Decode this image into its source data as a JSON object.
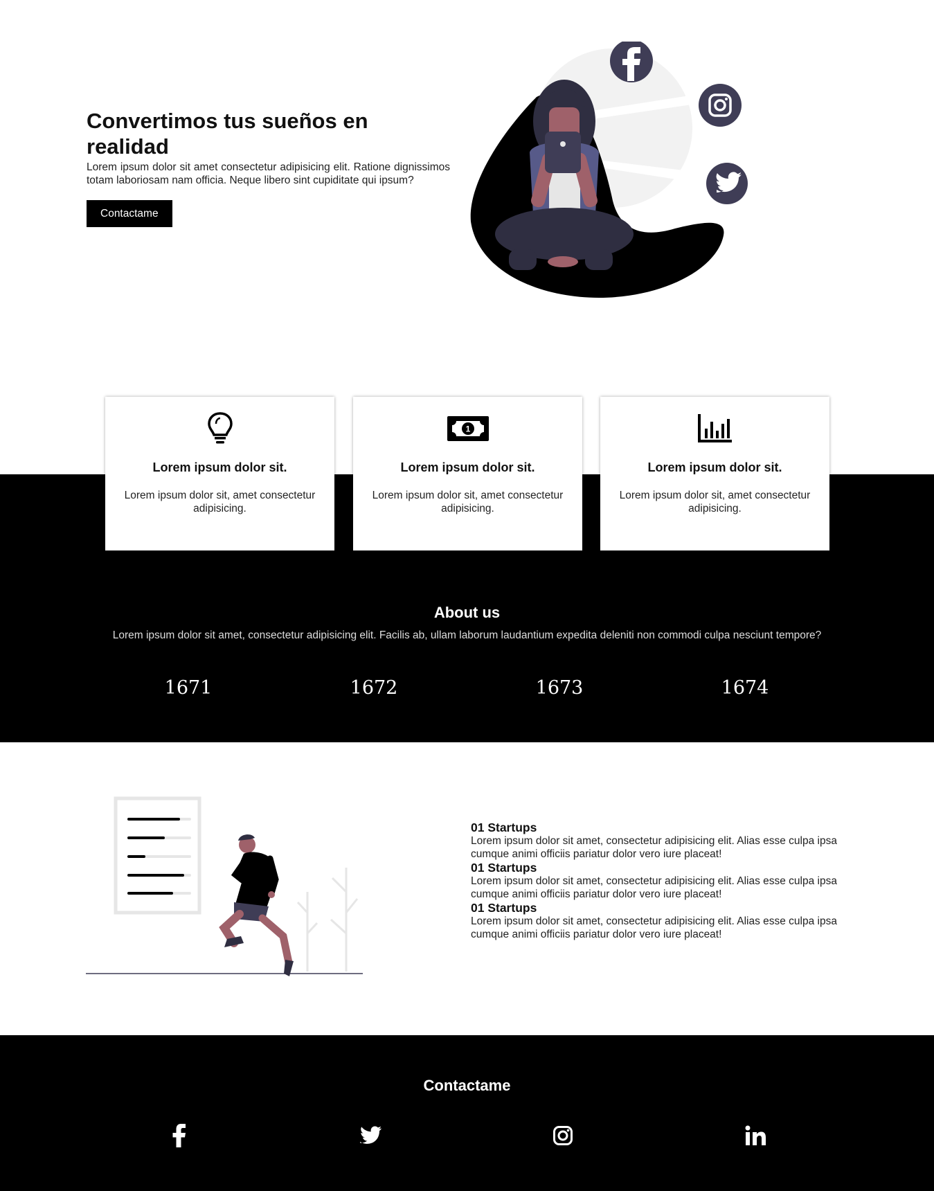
{
  "hero": {
    "title": "Convertimos tus sueños en realidad",
    "description": "Lorem ipsum dolor sit amet consectetur adipisicing elit. Ratione dignissimos totam laboriosam nam officia. Neque libero sint cupiditate qui ipsum?",
    "button_label": "Contactame",
    "illustration_icons": [
      "facebook-icon",
      "instagram-icon",
      "twitter-icon"
    ]
  },
  "features": [
    {
      "icon": "lightbulb-icon",
      "title": "Lorem ipsum dolor sit.",
      "text": "Lorem ipsum dolor sit, amet consectetur adipisicing."
    },
    {
      "icon": "money-bill-icon",
      "title": "Lorem ipsum dolor sit.",
      "text": "Lorem ipsum dolor sit, amet consectetur adipisicing."
    },
    {
      "icon": "bar-chart-icon",
      "title": "Lorem ipsum dolor sit.",
      "text": "Lorem ipsum dolor sit, amet consectetur adipisicing."
    }
  ],
  "about": {
    "title": "About us",
    "description": "Lorem ipsum dolor sit amet, consectetur adipisicing elit. Facilis ab, ullam laborum laudantium expedita deleniti non commodi culpa nesciunt tempore?",
    "stats": [
      "1671",
      "1672",
      "1673",
      "1674"
    ]
  },
  "startups": [
    {
      "title": "01 Startups",
      "text": "Lorem ipsum dolor sit amet, consectetur adipisicing elit. Alias esse culpa ipsa cumque animi officiis pariatur dolor vero iure placeat!"
    },
    {
      "title": "01 Startups",
      "text": "Lorem ipsum dolor sit amet, consectetur adipisicing elit. Alias esse culpa ipsa cumque animi officiis pariatur dolor vero iure placeat!"
    },
    {
      "title": "01 Startups",
      "text": "Lorem ipsum dolor sit amet, consectetur adipisicing elit. Alias esse culpa ipsa cumque animi officiis pariatur dolor vero iure placeat!"
    }
  ],
  "footer": {
    "title": "Contactame",
    "social": [
      "facebook-icon",
      "twitter-icon",
      "instagram-icon",
      "linkedin-icon"
    ]
  },
  "colors": {
    "black": "#000000",
    "illustration_navy": "#3f3d56",
    "illustration_purple": "#575a89",
    "illustration_skin": "#9f616a",
    "illustration_light": "#f2f2f2"
  }
}
